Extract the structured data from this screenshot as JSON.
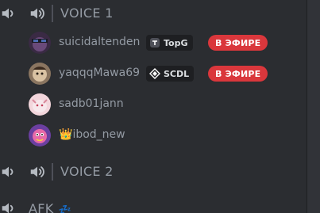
{
  "channels": [
    {
      "name": "VOICE 1",
      "users": [
        {
          "name": "suicidaltenden",
          "tag": {
            "label": "TopG",
            "icon": "topg-icon"
          },
          "live": "В ЭФИРЕ"
        },
        {
          "name": "yaqqqMawa69",
          "tag": {
            "label": "SCDL",
            "icon": "diamond-icon"
          },
          "live": "В ЭФИРЕ"
        },
        {
          "name": "sadb01jann"
        },
        {
          "name": "ibod_new",
          "prefix": "👑"
        }
      ]
    },
    {
      "name": "VOICE 2",
      "users": []
    },
    {
      "name": "AFK",
      "suffix": "💤",
      "users": []
    }
  ],
  "colors": {
    "background": "#2b2d31",
    "text_muted": "#949ba4",
    "live_red": "#da373c",
    "tag_bg": "#1e1f22"
  }
}
